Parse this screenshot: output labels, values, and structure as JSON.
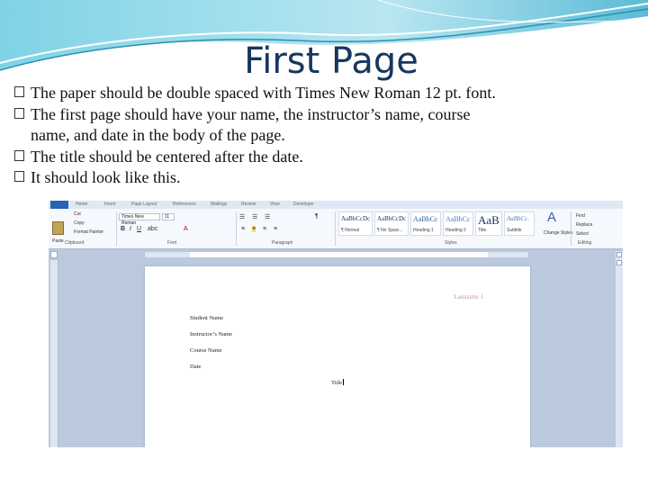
{
  "slide": {
    "title": "First Page",
    "bullets": [
      {
        "line1": "The paper should be double spaced with Times New Roman 12 pt. font.",
        "line2": ""
      },
      {
        "line1": "The first page should have your name, the instructor’s name, course",
        "line2": "name, and date in the body of the page."
      },
      {
        "line1": "The title should be centered after the date.",
        "line2": ""
      },
      {
        "line1": "It should look like this.",
        "line2": ""
      }
    ],
    "bullet_icon": "checkbox-bullet-icon",
    "title_color": "#17375e"
  },
  "word": {
    "tabs": [
      "Home",
      "Insert",
      "Page Layout",
      "References",
      "Mailings",
      "Review",
      "View",
      "Developer"
    ],
    "clipboard": {
      "paste": "Paste",
      "cut": "Cut",
      "copy": "Copy",
      "format_painter": "Format Painter",
      "label": "Clipboard"
    },
    "font": {
      "name": "Times New Roman",
      "size": "11",
      "label": "Font"
    },
    "paragraph_label": "Paragraph",
    "styles": {
      "label": "Styles",
      "items": [
        {
          "preview": "AaBbCcDc",
          "name": "¶ Normal"
        },
        {
          "preview": "AaBbCcDc",
          "name": "¶ No Spaci..."
        },
        {
          "preview": "AaBbCc",
          "name": "Heading 1"
        },
        {
          "preview": "AaBbCc",
          "name": "Heading 2"
        },
        {
          "preview": "AaB",
          "name": "Title"
        },
        {
          "preview": "AaBbCc.",
          "name": "Subtitle"
        }
      ],
      "change_styles": "Change Styles"
    },
    "editing": {
      "find": "Find",
      "replace": "Replace",
      "select": "Select",
      "label": "Editing"
    },
    "document": {
      "header": "Lastname 1",
      "lines": [
        "Student Name",
        "Instructor’s Name",
        "Course Name",
        "Date"
      ],
      "title": "Title"
    },
    "ribbon_accent": "#2b63b5"
  }
}
